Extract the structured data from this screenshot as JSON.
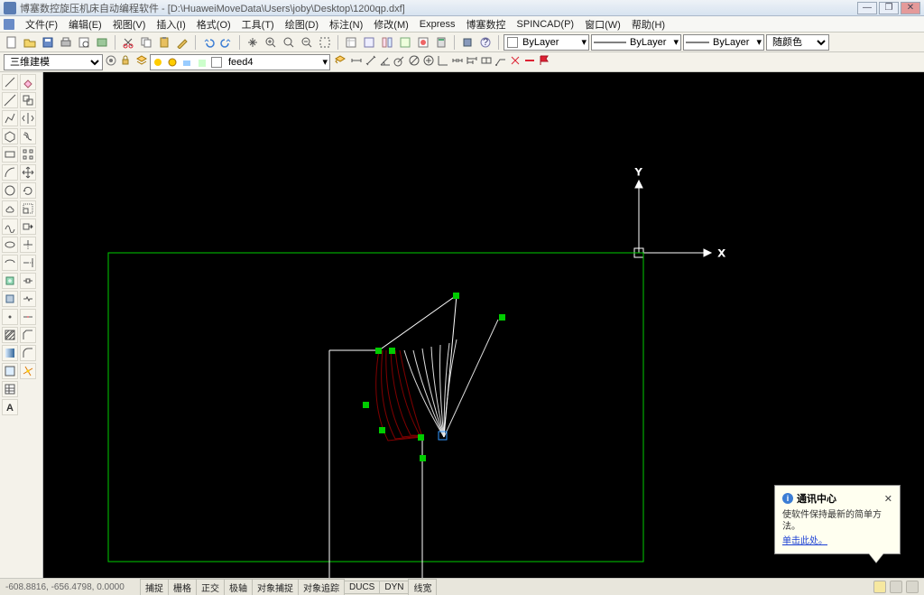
{
  "title": "博塞数控旋压机床自动编程软件 - [D:\\HuaweiMoveData\\Users\\joby\\Desktop\\1200qp.dxf]",
  "menu": {
    "file": "文件(F)",
    "edit": "编辑(E)",
    "view": "视图(V)",
    "insert": "插入(I)",
    "format": "格式(O)",
    "tools": "工具(T)",
    "draw": "绘图(D)",
    "annotate": "标注(N)",
    "modify": "修改(M)",
    "express": "Express",
    "cnc": "博塞数控",
    "spincad": "SPINCAD(P)",
    "window": "窗口(W)",
    "help": "帮助(H)"
  },
  "layers": {
    "bylayer1": "ByLayer",
    "bylayer2": "ByLayer",
    "bylayer3": "ByLayer",
    "color": "随颜色"
  },
  "secbar": {
    "mode": "三维建模",
    "layer": "feed4"
  },
  "status": {
    "coord": "-608.8816, -656.4798, 0.0000",
    "buttons": [
      "捕捉",
      "栅格",
      "正交",
      "极轴",
      "对象捕捉",
      "对象追踪",
      "DUCS",
      "DYN",
      "线宽"
    ]
  },
  "tooltip": {
    "title": "通讯中心",
    "body": "使软件保持最新的简单方法。",
    "link": "单击此处。"
  },
  "axis": {
    "x": "X",
    "y": "Y"
  }
}
